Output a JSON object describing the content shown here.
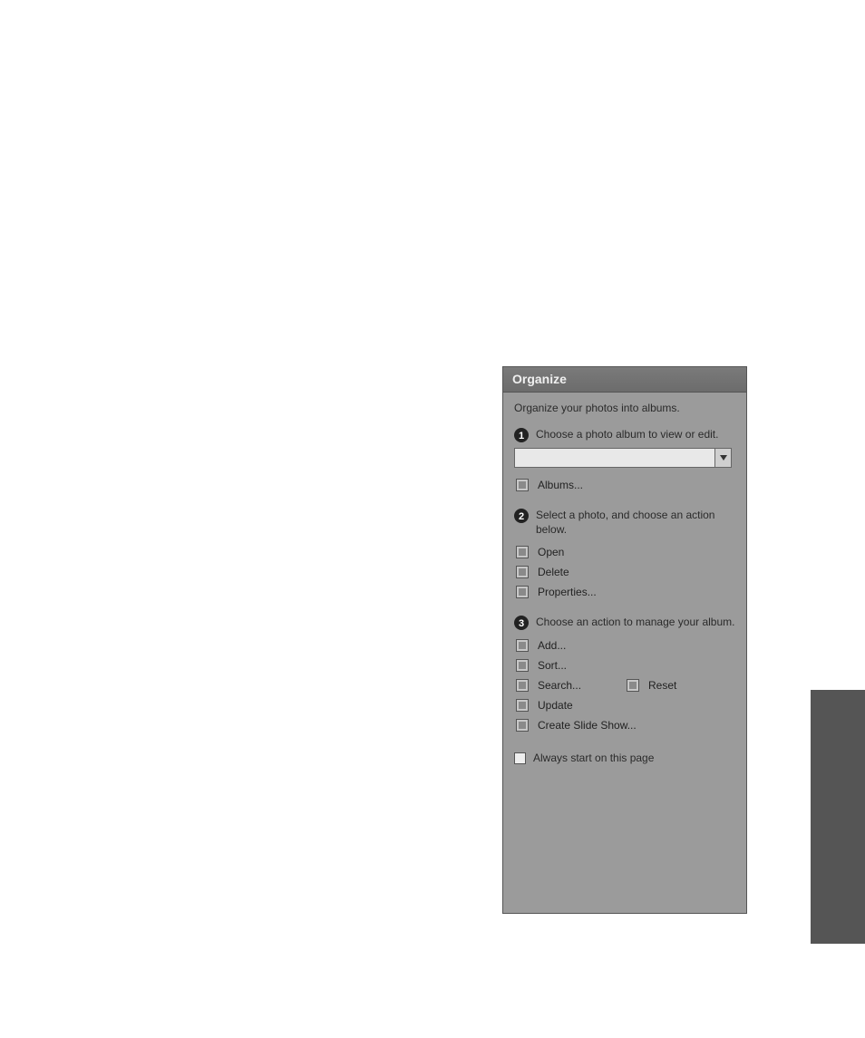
{
  "panel": {
    "title": "Organize",
    "intro": "Organize your photos into albums.",
    "step1": {
      "text": "Choose a photo album to view or edit.",
      "dropdown_value": ""
    },
    "options": {
      "albums": "Albums..."
    },
    "step2": {
      "text": "Select a photo, and choose an action below.",
      "open": "Open",
      "delete": "Delete",
      "properties": "Properties..."
    },
    "step3": {
      "text": "Choose an action to manage your album.",
      "add": "Add...",
      "sort": "Sort...",
      "search": "Search...",
      "reset": "Reset",
      "update": "Update",
      "slideshow": "Create Slide Show..."
    },
    "always": "Always start on this page"
  }
}
